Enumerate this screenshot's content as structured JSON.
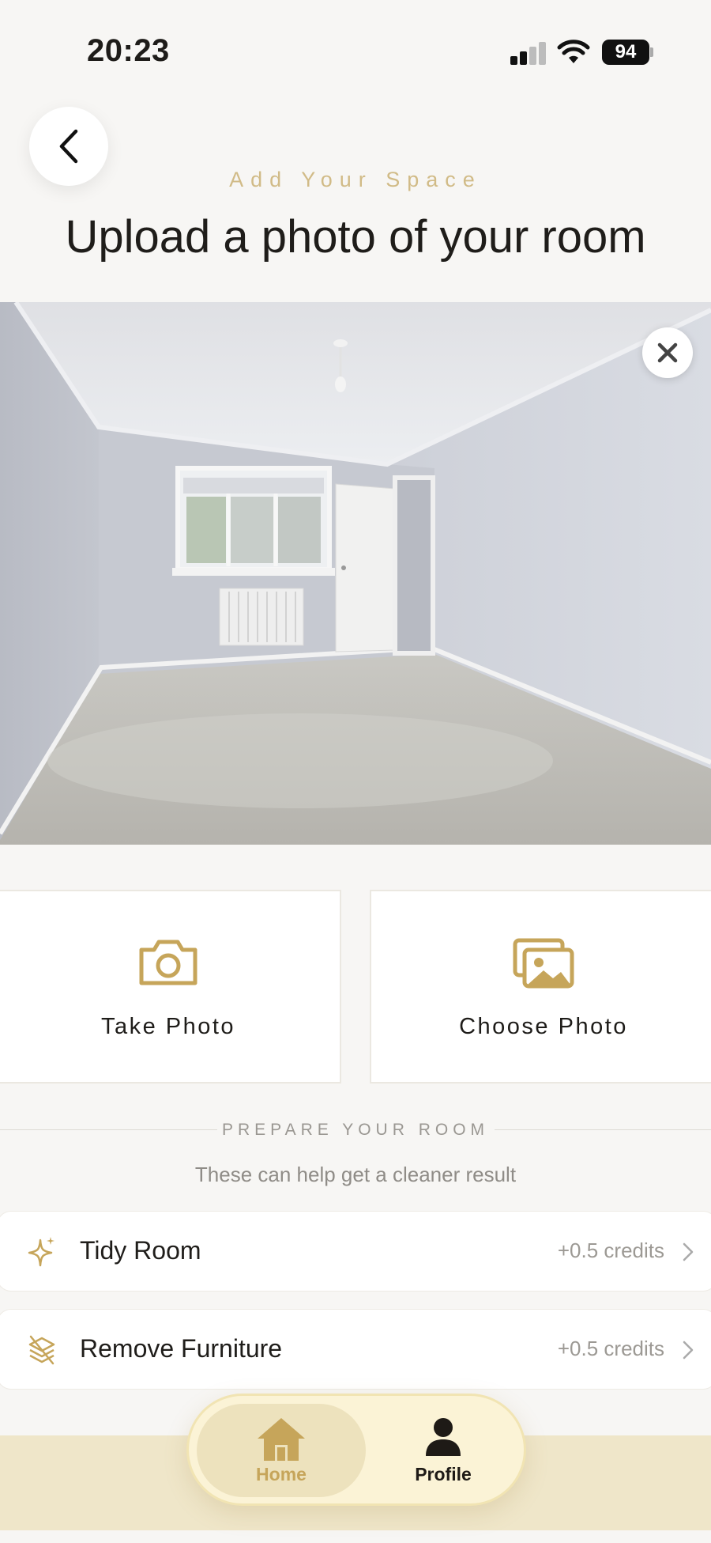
{
  "status_bar": {
    "time": "20:23",
    "battery": "94"
  },
  "header": {
    "eyebrow": "Add Your Space",
    "title": "Upload a photo of your room"
  },
  "photo": {
    "alt": "Empty room photo"
  },
  "actions": [
    {
      "label": "Take Photo",
      "icon": "camera-icon"
    },
    {
      "label": "Choose Photo",
      "icon": "gallery-icon"
    }
  ],
  "prepare": {
    "heading": "PREPARE YOUR ROOM",
    "subtitle": "These can help get a cleaner result",
    "options": [
      {
        "label": "Tidy Room",
        "credits": "+0.5 credits",
        "icon": "sparkle-icon"
      },
      {
        "label": "Remove Furniture",
        "credits": "+0.5 credits",
        "icon": "layers-strike-icon"
      }
    ]
  },
  "tabbar": {
    "tabs": [
      {
        "label": "Home",
        "icon": "home-icon",
        "active": true
      },
      {
        "label": "Profile",
        "icon": "person-icon",
        "active": false
      }
    ]
  },
  "colors": {
    "accent_gold": "#c6a55a",
    "background": "#f7f6f4",
    "tabbar_bg": "#fbf3d6"
  }
}
